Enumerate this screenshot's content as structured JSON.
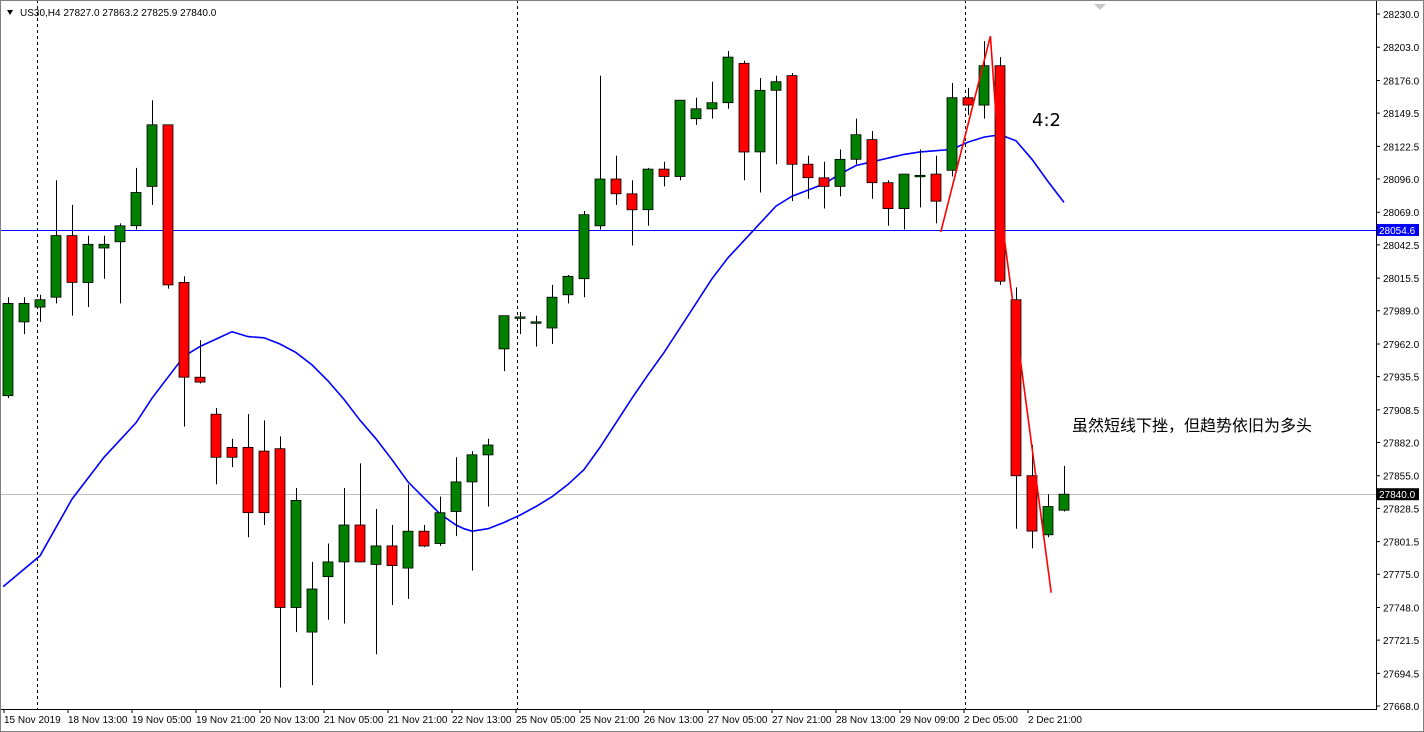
{
  "header": {
    "symbol_info": "US30,H4  27827.0 27863.2 27825.9 27840.0"
  },
  "annotations": {
    "ratio": "4:2",
    "comment": "虽然短线下挫，但趋势依旧为多头"
  },
  "price_tags": {
    "horizontal_line": "28054.6",
    "current_price": "27840.0"
  },
  "colors": {
    "bull": "#008000",
    "bear": "#ff0000",
    "ma": "#0000ff",
    "hline": "#0000ff",
    "pattern": "#ff0000",
    "current": "#c0c0c0"
  },
  "chart_data": {
    "type": "candlestick",
    "ylim": [
      27668,
      28230
    ],
    "y_ticks": [
      28230.0,
      28203.0,
      28176.0,
      28149.5,
      28122.5,
      28096.0,
      28069.0,
      28042.5,
      28015.5,
      27989.0,
      27962.0,
      27935.5,
      27908.5,
      27882.0,
      27855.0,
      27828.5,
      27801.5,
      27775.0,
      27748.0,
      27721.5,
      27694.5,
      27668.0
    ],
    "x_labels": [
      {
        "text": "15 Nov 2019",
        "i": 0
      },
      {
        "text": "18 Nov 13:00",
        "i": 4
      },
      {
        "text": "19 Nov 05:00",
        "i": 8
      },
      {
        "text": "19 Nov 21:00",
        "i": 12
      },
      {
        "text": "20 Nov 13:00",
        "i": 16
      },
      {
        "text": "21 Nov 05:00",
        "i": 20
      },
      {
        "text": "21 Nov 21:00",
        "i": 24
      },
      {
        "text": "22 Nov 13:00",
        "i": 28
      },
      {
        "text": "25 Nov 05:00",
        "i": 32
      },
      {
        "text": "25 Nov 21:00",
        "i": 36
      },
      {
        "text": "26 Nov 13:00",
        "i": 40
      },
      {
        "text": "27 Nov 05:00",
        "i": 44
      },
      {
        "text": "27 Nov 21:00",
        "i": 48
      },
      {
        "text": "28 Nov 13:00",
        "i": 52
      },
      {
        "text": "29 Nov 09:00",
        "i": 56
      },
      {
        "text": "2 Dec 05:00",
        "i": 60
      },
      {
        "text": "2 Dec 21:00",
        "i": 64
      }
    ],
    "separators_i": [
      1,
      31,
      59
    ],
    "candles": [
      {
        "o": 27920,
        "h": 28000,
        "l": 27918,
        "c": 27995
      },
      {
        "o": 27980,
        "h": 28000,
        "l": 27970,
        "c": 27995
      },
      {
        "o": 27992,
        "h": 28002,
        "l": 27980,
        "c": 27998
      },
      {
        "o": 28000,
        "h": 28095,
        "l": 27995,
        "c": 28050
      },
      {
        "o": 28050,
        "h": 28075,
        "l": 27985,
        "c": 28012
      },
      {
        "o": 28012,
        "h": 28050,
        "l": 27992,
        "c": 28043
      },
      {
        "o": 28040,
        "h": 28050,
        "l": 28015,
        "c": 28043
      },
      {
        "o": 28045,
        "h": 28060,
        "l": 27995,
        "c": 28058
      },
      {
        "o": 28058,
        "h": 28105,
        "l": 28055,
        "c": 28085
      },
      {
        "o": 28090,
        "h": 28160,
        "l": 28075,
        "c": 28140
      },
      {
        "o": 28140,
        "h": 28140,
        "l": 28007,
        "c": 28010
      },
      {
        "o": 28012,
        "h": 28017,
        "l": 27895,
        "c": 27935
      },
      {
        "o": 27935,
        "h": 27965,
        "l": 27930,
        "c": 27931
      },
      {
        "o": 27905,
        "h": 27910,
        "l": 27848,
        "c": 27870
      },
      {
        "o": 27878,
        "h": 27885,
        "l": 27862,
        "c": 27870
      },
      {
        "o": 27878,
        "h": 27905,
        "l": 27805,
        "c": 27825
      },
      {
        "o": 27875,
        "h": 27900,
        "l": 27815,
        "c": 27825
      },
      {
        "o": 27877,
        "h": 27887,
        "l": 27683,
        "c": 27748
      },
      {
        "o": 27748,
        "h": 27845,
        "l": 27728,
        "c": 27835
      },
      {
        "o": 27728,
        "h": 27785,
        "l": 27685,
        "c": 27763
      },
      {
        "o": 27773,
        "h": 27800,
        "l": 27738,
        "c": 27785
      },
      {
        "o": 27785,
        "h": 27845,
        "l": 27735,
        "c": 27815
      },
      {
        "o": 27815,
        "h": 27865,
        "l": 27785,
        "c": 27785
      },
      {
        "o": 27783,
        "h": 27828,
        "l": 27710,
        "c": 27798
      },
      {
        "o": 27798,
        "h": 27815,
        "l": 27750,
        "c": 27782
      },
      {
        "o": 27780,
        "h": 27848,
        "l": 27755,
        "c": 27810
      },
      {
        "o": 27810,
        "h": 27815,
        "l": 27797,
        "c": 27798
      },
      {
        "o": 27800,
        "h": 27838,
        "l": 27798,
        "c": 27825
      },
      {
        "o": 27826,
        "h": 27870,
        "l": 27806,
        "c": 27850
      },
      {
        "o": 27850,
        "h": 27875,
        "l": 27778,
        "c": 27872
      },
      {
        "o": 27872,
        "h": 27885,
        "l": 27830,
        "c": 27880
      },
      {
        "o": 27958,
        "h": 27975,
        "l": 27940,
        "c": 27985
      },
      {
        "o": 27983,
        "h": 27988,
        "l": 27970,
        "c": 27984
      },
      {
        "o": 27980,
        "h": 27985,
        "l": 27960,
        "c": 27980
      },
      {
        "o": 27975,
        "h": 28010,
        "l": 27962,
        "c": 28000
      },
      {
        "o": 28002,
        "h": 28018,
        "l": 27995,
        "c": 28017
      },
      {
        "o": 28015,
        "h": 28070,
        "l": 28000,
        "c": 28067
      },
      {
        "o": 28058,
        "h": 28180,
        "l": 28055,
        "c": 28096
      },
      {
        "o": 28096,
        "h": 28115,
        "l": 28075,
        "c": 28084
      },
      {
        "o": 28084,
        "h": 28095,
        "l": 28042,
        "c": 28071
      },
      {
        "o": 28071,
        "h": 28105,
        "l": 28058,
        "c": 28104
      },
      {
        "o": 28104,
        "h": 28110,
        "l": 28090,
        "c": 28098
      },
      {
        "o": 28098,
        "h": 28160,
        "l": 28095,
        "c": 28160
      },
      {
        "o": 28145,
        "h": 28162,
        "l": 28140,
        "c": 28153
      },
      {
        "o": 28153,
        "h": 28175,
        "l": 28145,
        "c": 28158
      },
      {
        "o": 28158,
        "h": 28200,
        "l": 28153,
        "c": 28195
      },
      {
        "o": 28190,
        "h": 28192,
        "l": 28095,
        "c": 28118
      },
      {
        "o": 28118,
        "h": 28178,
        "l": 28085,
        "c": 28168
      },
      {
        "o": 28168,
        "h": 28180,
        "l": 28108,
        "c": 28175
      },
      {
        "o": 28180,
        "h": 28182,
        "l": 28078,
        "c": 28108
      },
      {
        "o": 28108,
        "h": 28115,
        "l": 28080,
        "c": 28097
      },
      {
        "o": 28097,
        "h": 28110,
        "l": 28072,
        "c": 28090
      },
      {
        "o": 28090,
        "h": 28120,
        "l": 28082,
        "c": 28112
      },
      {
        "o": 28112,
        "h": 28145,
        "l": 28108,
        "c": 28132
      },
      {
        "o": 28128,
        "h": 28135,
        "l": 28080,
        "c": 28093
      },
      {
        "o": 28093,
        "h": 28095,
        "l": 28058,
        "c": 28072
      },
      {
        "o": 28072,
        "h": 28100,
        "l": 28055,
        "c": 28100
      },
      {
        "o": 28098,
        "h": 28120,
        "l": 28073,
        "c": 28099
      },
      {
        "o": 28100,
        "h": 28115,
        "l": 28060,
        "c": 28078
      },
      {
        "o": 28103,
        "h": 28174,
        "l": 28098,
        "c": 28162
      },
      {
        "o": 28162,
        "h": 28170,
        "l": 28148,
        "c": 28156
      },
      {
        "o": 28156,
        "h": 28208,
        "l": 28145,
        "c": 28188
      },
      {
        "o": 28188,
        "h": 28195,
        "l": 28010,
        "c": 28013
      },
      {
        "o": 27998,
        "h": 28008,
        "l": 27812,
        "c": 27855
      },
      {
        "o": 27855,
        "h": 27880,
        "l": 27796,
        "c": 27810
      },
      {
        "o": 27807,
        "h": 27840,
        "l": 27805,
        "c": 27830
      },
      {
        "o": 27827,
        "h": 27863,
        "l": 27826,
        "c": 27840
      }
    ],
    "ma_points": [
      [
        -0.3,
        27765
      ],
      [
        2,
        27790
      ],
      [
        4,
        27836
      ],
      [
        6,
        27870
      ],
      [
        8,
        27898
      ],
      [
        9,
        27918
      ],
      [
        10,
        27935
      ],
      [
        11,
        27952
      ],
      [
        12,
        27960
      ],
      [
        13,
        27966
      ],
      [
        14,
        27972
      ],
      [
        15,
        27968
      ],
      [
        16,
        27967
      ],
      [
        17,
        27962
      ],
      [
        18,
        27955
      ],
      [
        19,
        27945
      ],
      [
        20,
        27932
      ],
      [
        21,
        27917
      ],
      [
        22,
        27900
      ],
      [
        23,
        27885
      ],
      [
        24,
        27868
      ],
      [
        25,
        27850
      ],
      [
        26,
        27837
      ],
      [
        27,
        27824
      ],
      [
        28,
        27815
      ],
      [
        28.5,
        27812
      ],
      [
        29,
        27810
      ],
      [
        30,
        27812
      ],
      [
        31,
        27817
      ],
      [
        32,
        27823
      ],
      [
        33,
        27830
      ],
      [
        34,
        27838
      ],
      [
        35,
        27848
      ],
      [
        36,
        27860
      ],
      [
        37,
        27878
      ],
      [
        38,
        27898
      ],
      [
        39,
        27918
      ],
      [
        40,
        27937
      ],
      [
        41,
        27955
      ],
      [
        42,
        27975
      ],
      [
        43,
        27995
      ],
      [
        44,
        28015
      ],
      [
        45,
        28032
      ],
      [
        46,
        28046
      ],
      [
        47,
        28060
      ],
      [
        48,
        28074
      ],
      [
        49,
        28082
      ],
      [
        50,
        28087
      ],
      [
        51,
        28092
      ],
      [
        52,
        28100
      ],
      [
        53,
        28107
      ],
      [
        54,
        28110
      ],
      [
        55,
        28113
      ],
      [
        56,
        28116
      ],
      [
        57,
        28118
      ],
      [
        58,
        28119
      ],
      [
        59,
        28120
      ],
      [
        60,
        28126
      ],
      [
        61,
        28130
      ],
      [
        62,
        28132
      ],
      [
        63,
        28127
      ],
      [
        64,
        28112
      ],
      [
        65,
        28094
      ],
      [
        66,
        28077
      ]
    ],
    "hline_price": 28054.6,
    "current_price": 27840.0,
    "pattern_points": [
      [
        58.3,
        28053
      ],
      [
        61.4,
        28212
      ],
      [
        62.3,
        28045
      ],
      [
        65.2,
        27760
      ]
    ]
  }
}
